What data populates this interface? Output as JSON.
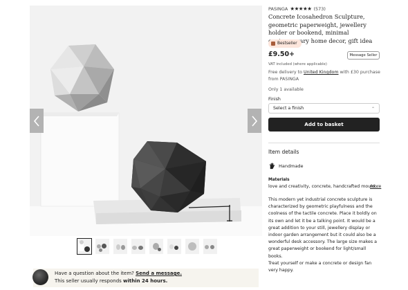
{
  "listing": {
    "shop_name": "PASINGA",
    "rating_stars": "★★★★★",
    "review_count": "(573)",
    "title": "Concrete Icosahedron Sculpture, geometric paperweight, jewellery holder or bookend, minimal contemporary home decor, gift idea",
    "badge": "Bestseller",
    "price": "£9.50+",
    "vat_note": "VAT included (where applicable)",
    "message_seller": "Message Seller",
    "delivery_prefix": "Free delivery to ",
    "delivery_country": "United Kingdom",
    "delivery_suffix": " with £30 purchase from PASINGA",
    "stock": "Only 1 available",
    "finish_label": "Finish",
    "finish_selected": "Select a finish",
    "add_to_basket": "Add to basket",
    "item_details_heading": "Item details",
    "handmade": "Handmade",
    "materials_heading": "Materials",
    "materials_text": "love and creativity, concrete, handcrafted mould...",
    "more_link": "more",
    "description_1": "This modern yet industrial concrete sculpture is characterized by geometric playfulness and the coolness of the tactile concrete. Place it boldly on its own and let it be a talking point. It would be a great addition to your still, jewellery display or indoor garden arrangement but it could also be a wonderful desk accessory. The large size makes a great paperweight or bookend for light/small books.",
    "description_2": "Treat yourself or make a concrete or design fan very happy."
  },
  "help": {
    "question_prefix": "Have a question about the item? ",
    "send_message": "Send a message.",
    "response_prefix": "This seller usually responds ",
    "response_time": "within 24 hours."
  },
  "gallery": {
    "thumbnail_count": 8,
    "active_thumbnail": 1
  },
  "colors": {
    "button_dark": "#222222",
    "badge_bg": "#fde6dc",
    "help_bg": "#f6f4ee",
    "arrow_bg": "#b3b3b3"
  }
}
